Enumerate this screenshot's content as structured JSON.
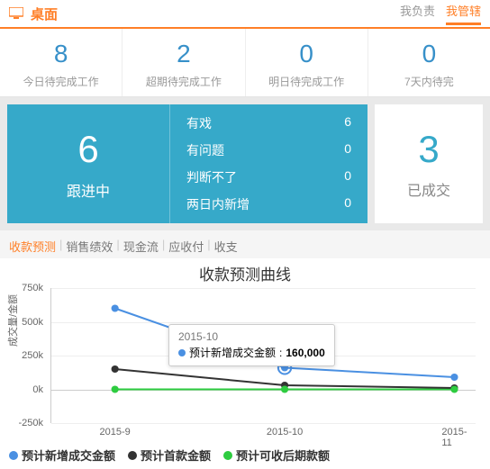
{
  "header": {
    "title": "桌面",
    "tabs": [
      "我负责",
      "我管辖"
    ],
    "active_tab": 1
  },
  "summary": [
    {
      "value": "8",
      "label": "今日待完成工作"
    },
    {
      "value": "2",
      "label": "超期待完成工作"
    },
    {
      "value": "0",
      "label": "明日待完成工作"
    },
    {
      "value": "0",
      "label": "7天内待完"
    }
  ],
  "follow_card": {
    "num": "6",
    "label": "跟进中",
    "items": [
      {
        "name": "有戏",
        "count": "6"
      },
      {
        "name": "有问题",
        "count": "0"
      },
      {
        "name": "判断不了",
        "count": "0"
      },
      {
        "name": "两日内新增",
        "count": "0"
      }
    ]
  },
  "done_card": {
    "num": "3",
    "label": "已成交"
  },
  "tabs": {
    "items": [
      "收款预测",
      "销售绩效",
      "现金流",
      "应收付",
      "收支"
    ],
    "active": 0,
    "sep": "|"
  },
  "chart_data": {
    "type": "line",
    "title": "收款预测曲线",
    "ylabel": "成交量/金额",
    "yticks": [
      "-250k",
      "0k",
      "250k",
      "500k",
      "750k"
    ],
    "ylim": [
      -250000,
      750000
    ],
    "categories": [
      "2015-9",
      "2015-10",
      "2015-11"
    ],
    "series": [
      {
        "name": "预计新增成交金额",
        "color": "#4a90e2",
        "values": [
          600000,
          160000,
          90000
        ]
      },
      {
        "name": "预计首款金额",
        "color": "#333333",
        "values": [
          150000,
          30000,
          10000
        ]
      },
      {
        "name": "预计可收后期款额",
        "color": "#2ecc40",
        "values": [
          0,
          0,
          0
        ]
      }
    ],
    "tooltip": {
      "category": "2015-10",
      "series_name": "预计新增成交金额",
      "value": "160,000",
      "color": "#4a90e2"
    }
  },
  "legend_prefix": "—"
}
